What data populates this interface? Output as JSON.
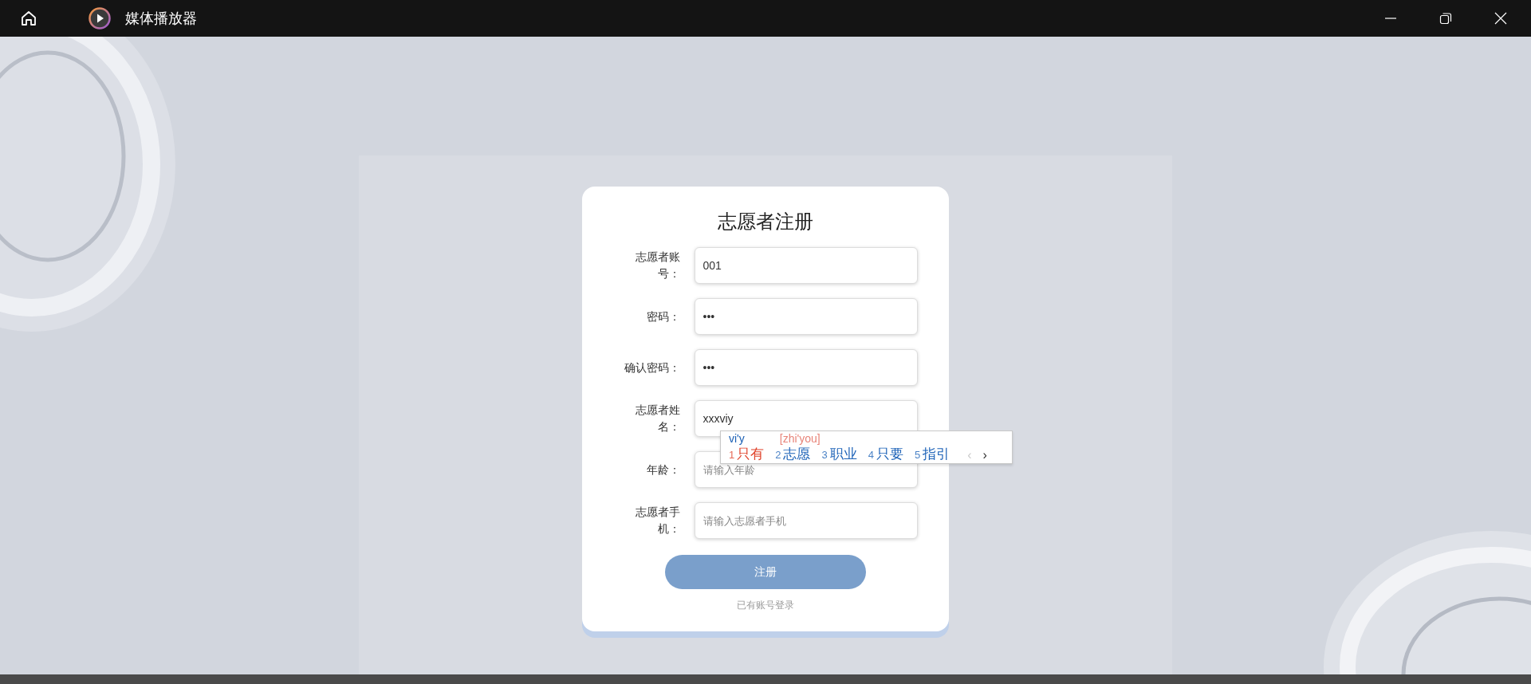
{
  "window": {
    "title": "媒体播放器"
  },
  "form": {
    "title": "志愿者注册",
    "fields": [
      {
        "label": "志愿者账号：",
        "value": "001"
      },
      {
        "label": "密码：",
        "value": "•••"
      },
      {
        "label": "确认密码：",
        "value": "•••"
      },
      {
        "label": "志愿者姓名：",
        "value": "xxxviy"
      },
      {
        "label": "年龄：",
        "placeholder": "请输入年龄"
      },
      {
        "label": "志愿者手机：",
        "placeholder": "请输入志愿者手机"
      }
    ],
    "submit": "注册",
    "login_link": "已有账号登录"
  },
  "ime": {
    "composition": "vi'y",
    "hint": "[zhi'you]",
    "candidates": [
      {
        "number": "1",
        "text": "只有",
        "selected": true
      },
      {
        "number": "2",
        "text": "志愿",
        "selected": false
      },
      {
        "number": "3",
        "text": "职业",
        "selected": false
      },
      {
        "number": "4",
        "text": "只要",
        "selected": false
      },
      {
        "number": "5",
        "text": "指引",
        "selected": false
      }
    ],
    "prev": {
      "text": "‹",
      "disabled": true
    },
    "next": {
      "text": "›",
      "disabled": false
    }
  }
}
